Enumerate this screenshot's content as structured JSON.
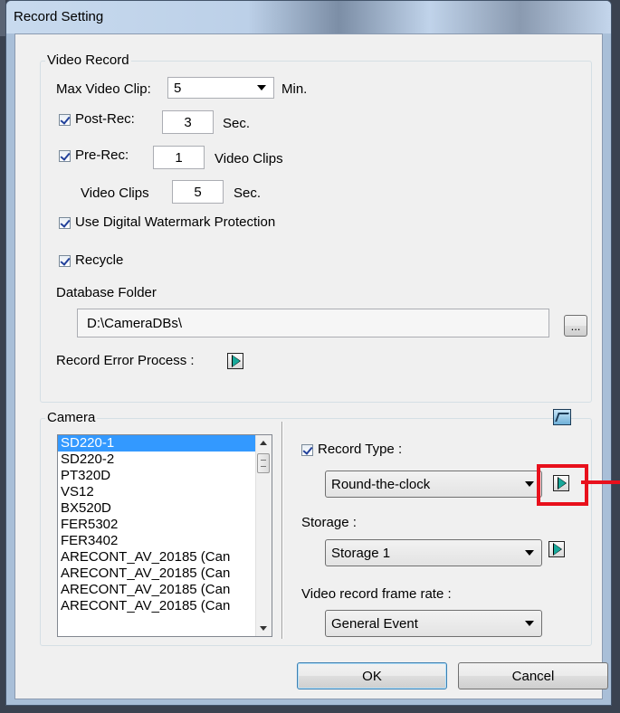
{
  "window": {
    "title": "Record Setting"
  },
  "video_record": {
    "legend": "Video Record",
    "max_clip_label": "Max Video Clip:",
    "max_clip_value": "5",
    "max_clip_unit": "Min.",
    "post_rec_label": "Post-Rec:",
    "post_rec_value": "3",
    "post_rec_unit": "Sec.",
    "pre_rec_label": "Pre-Rec:",
    "pre_rec_value": "1",
    "pre_rec_unit": "Video Clips",
    "clips_label": "Video Clips",
    "clips_value": "5",
    "clips_unit": "Sec.",
    "watermark_label": "Use Digital Watermark Protection",
    "recycle_label": "Recycle",
    "db_folder_label": "Database Folder",
    "db_folder_value": "D:\\CameraDBs\\",
    "browse_label": "...",
    "error_process_label": "Record Error Process :"
  },
  "camera": {
    "legend": "Camera",
    "items": [
      "SD220-1",
      "SD220-2",
      "PT320D",
      "VS12",
      "BX520D",
      "FER5302",
      "FER3402",
      "ARECONT_AV_20185 (Can",
      "ARECONT_AV_20185 (Can",
      "ARECONT_AV_20185 (Can",
      "ARECONT_AV_20185 (Can"
    ],
    "selected_index": 0,
    "record_type_label": "Record Type :",
    "record_type_value": "Round-the-clock",
    "storage_label": "Storage :",
    "storage_value": "Storage 1",
    "frame_rate_label": "Video record frame rate :",
    "frame_rate_value": "General Event"
  },
  "buttons": {
    "ok": "OK",
    "cancel": "Cancel"
  },
  "colors": {
    "highlight": "#e8101c",
    "selection": "#3399ff"
  }
}
